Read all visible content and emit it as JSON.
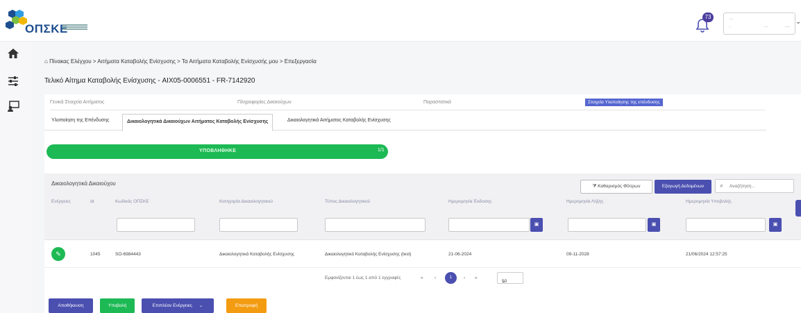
{
  "header": {
    "logo_text": "ΟΠΣΚΕ",
    "notifications_count": "73",
    "user": {
      "line1": "···",
      "line2a": "·",
      "line2b": "···",
      "line2c": "····"
    }
  },
  "breadcrumb": "Πίνακας Ελέγχου > Αιτήματα Καταβολής Ενίσχυσης > Τα Αιτήματα Καταβολής Ενίσχυσής μου > Επεξεργασία",
  "page_title": "Τελικό Αίτημα Καταβολής Ενίσχυσης - AIX05-0006551 - FR-7142920",
  "steps": [
    {
      "label": "Γενικά Στοιχεία Αιτήματος"
    },
    {
      "label": "Πληροφορίες Δικαιούχων"
    },
    {
      "label": "Παραστατικά"
    },
    {
      "label": "Στοιχεία Υλοποίησης της επένδυσης"
    }
  ],
  "tabs": [
    {
      "label": "Υλοποίηση της Επένδυσης"
    },
    {
      "label": "Δικαιολογητικά Δικαιούχων Αιτήματος Καταβολής Ενίσχυσης"
    },
    {
      "label": "Δικαιολογητικά Αιτήματος Καταβολής Ενίσχυσης"
    }
  ],
  "progress": {
    "label": "ΥΠΟΒΛΗΘΗΚΕ",
    "percent_text": "1/1",
    "fraction": 1.0
  },
  "section": {
    "title": "Δικαιολογητικά Δικαιούχου",
    "filter_button": "Καθαρισμός Φίλτρων",
    "export_button": "Εξαγωγή Δεδομένων",
    "search_placeholder": "Αναζήτηση..."
  },
  "table": {
    "columns": [
      "Ενέργειες",
      "Id",
      "Κωδικός ΟΠΣΚΕ",
      "Κατηγορία Δικαιολογητικού",
      "Τύπος Δικαιολογητικού",
      "Ημερομηνία Έκδοσης",
      "Ημερομηνία Λήξης",
      "Ημερομηνία Υποβολής"
    ],
    "rows": [
      [
        "",
        "1045",
        "SO-6984443",
        "Δικαιολογητικά Καταβολής Ενίσχυσης",
        "Δικαιολογητικό Καταβολής Ενίσχυσης (test)",
        "21-06-2024",
        "09-11-2028",
        "21/06/2024 12:57:25"
      ]
    ]
  },
  "pager": {
    "summary": "Εμφανίζονται 1 έως 1 από 1 εγγραφές",
    "current": "1",
    "per_page": "50"
  },
  "actions": {
    "save": "Αποθήκευση",
    "submit": "Υποβολή",
    "more": "Επιπλέον Ενέργειες",
    "back": "Επιστροφή"
  },
  "colors": {
    "accent": "#4a4fb0",
    "success": "#1db954",
    "warning": "#f39c12"
  }
}
